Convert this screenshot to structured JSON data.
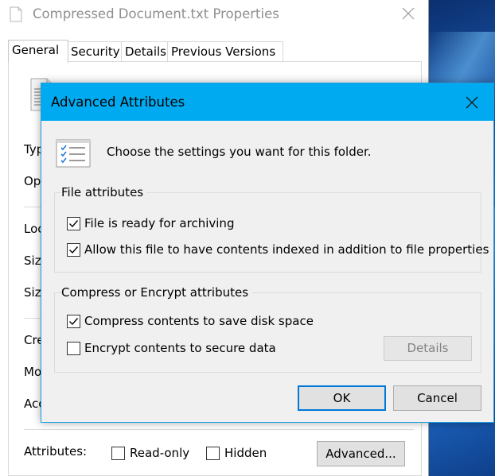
{
  "properties_window": {
    "title": "Compressed Document.txt Properties",
    "tabs": [
      {
        "label": "General",
        "active": true
      },
      {
        "label": "Security",
        "active": false
      },
      {
        "label": "Details",
        "active": false
      },
      {
        "label": "Previous Versions",
        "active": false
      }
    ],
    "row_labels": [
      "Typ",
      "Op",
      "Loc",
      "Siz",
      "Siz",
      "Cre",
      "Mo",
      "Acc"
    ],
    "attributes_label": "Attributes:",
    "readonly_label": "Read-only",
    "readonly_checked": false,
    "hidden_label": "Hidden",
    "hidden_checked": false,
    "advanced_button": "Advanced..."
  },
  "dialog": {
    "title": "Advanced Attributes",
    "description": "Choose the settings you want for this folder.",
    "file_attributes": {
      "title": "File attributes",
      "archive_label": "File is ready for archiving",
      "archive_checked": true,
      "index_label": "Allow this file to have contents indexed in addition to file properties",
      "index_checked": true
    },
    "compress_encrypt": {
      "title": "Compress or Encrypt attributes",
      "compress_label": "Compress contents to save disk space",
      "compress_checked": true,
      "encrypt_label": "Encrypt contents to secure data",
      "encrypt_checked": false,
      "details_button": "Details",
      "details_enabled": false
    },
    "ok_button": "OK",
    "cancel_button": "Cancel"
  },
  "colors": {
    "dialog_titlebar": "#00aaf0",
    "dialog_border": "#1a9fe0",
    "default_button_border": "#0078d7",
    "window_bg": "#f0f0f0"
  }
}
